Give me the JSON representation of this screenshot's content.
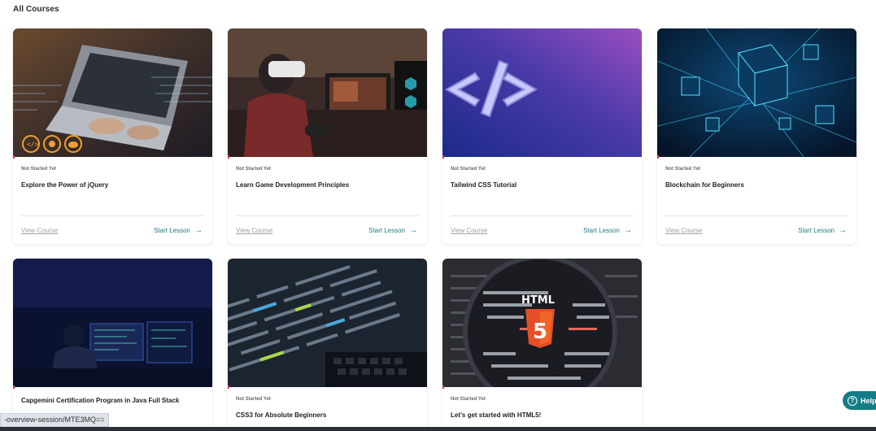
{
  "section_title": "All Courses",
  "status_url": "-overview-session/MTE3MQ==",
  "help_label": "Help",
  "accent_color": "#1b7d8a",
  "cards": [
    {
      "status": "Not Started Yet",
      "title": "Explore the Power of jQuery",
      "view": "View Course",
      "start": "Start Lesson"
    },
    {
      "status": "Not Started Yet",
      "title": "Learn Game Development Principles",
      "view": "View Course",
      "start": "Start Lesson"
    },
    {
      "status": "Not Started Yet",
      "title": "Tailwind CSS Tutorial",
      "view": "View Course",
      "start": "Start Lesson"
    },
    {
      "status": "Not Started Yet",
      "title": "Blockchain for Beginners",
      "view": "View Course",
      "start": "Start Lesson"
    },
    {
      "status": "",
      "title": "Capgemini Certification Program in Java Full Stack"
    },
    {
      "status": "Not Started Yet",
      "title": "CSS3 for Absolute Beginners"
    },
    {
      "status": "Not Started Yet",
      "title": "Let's get started with HTML5!"
    }
  ],
  "thumb_text": {
    "tailwind_glyph": "</>",
    "html_label": "HTML",
    "html_shield": "5"
  }
}
